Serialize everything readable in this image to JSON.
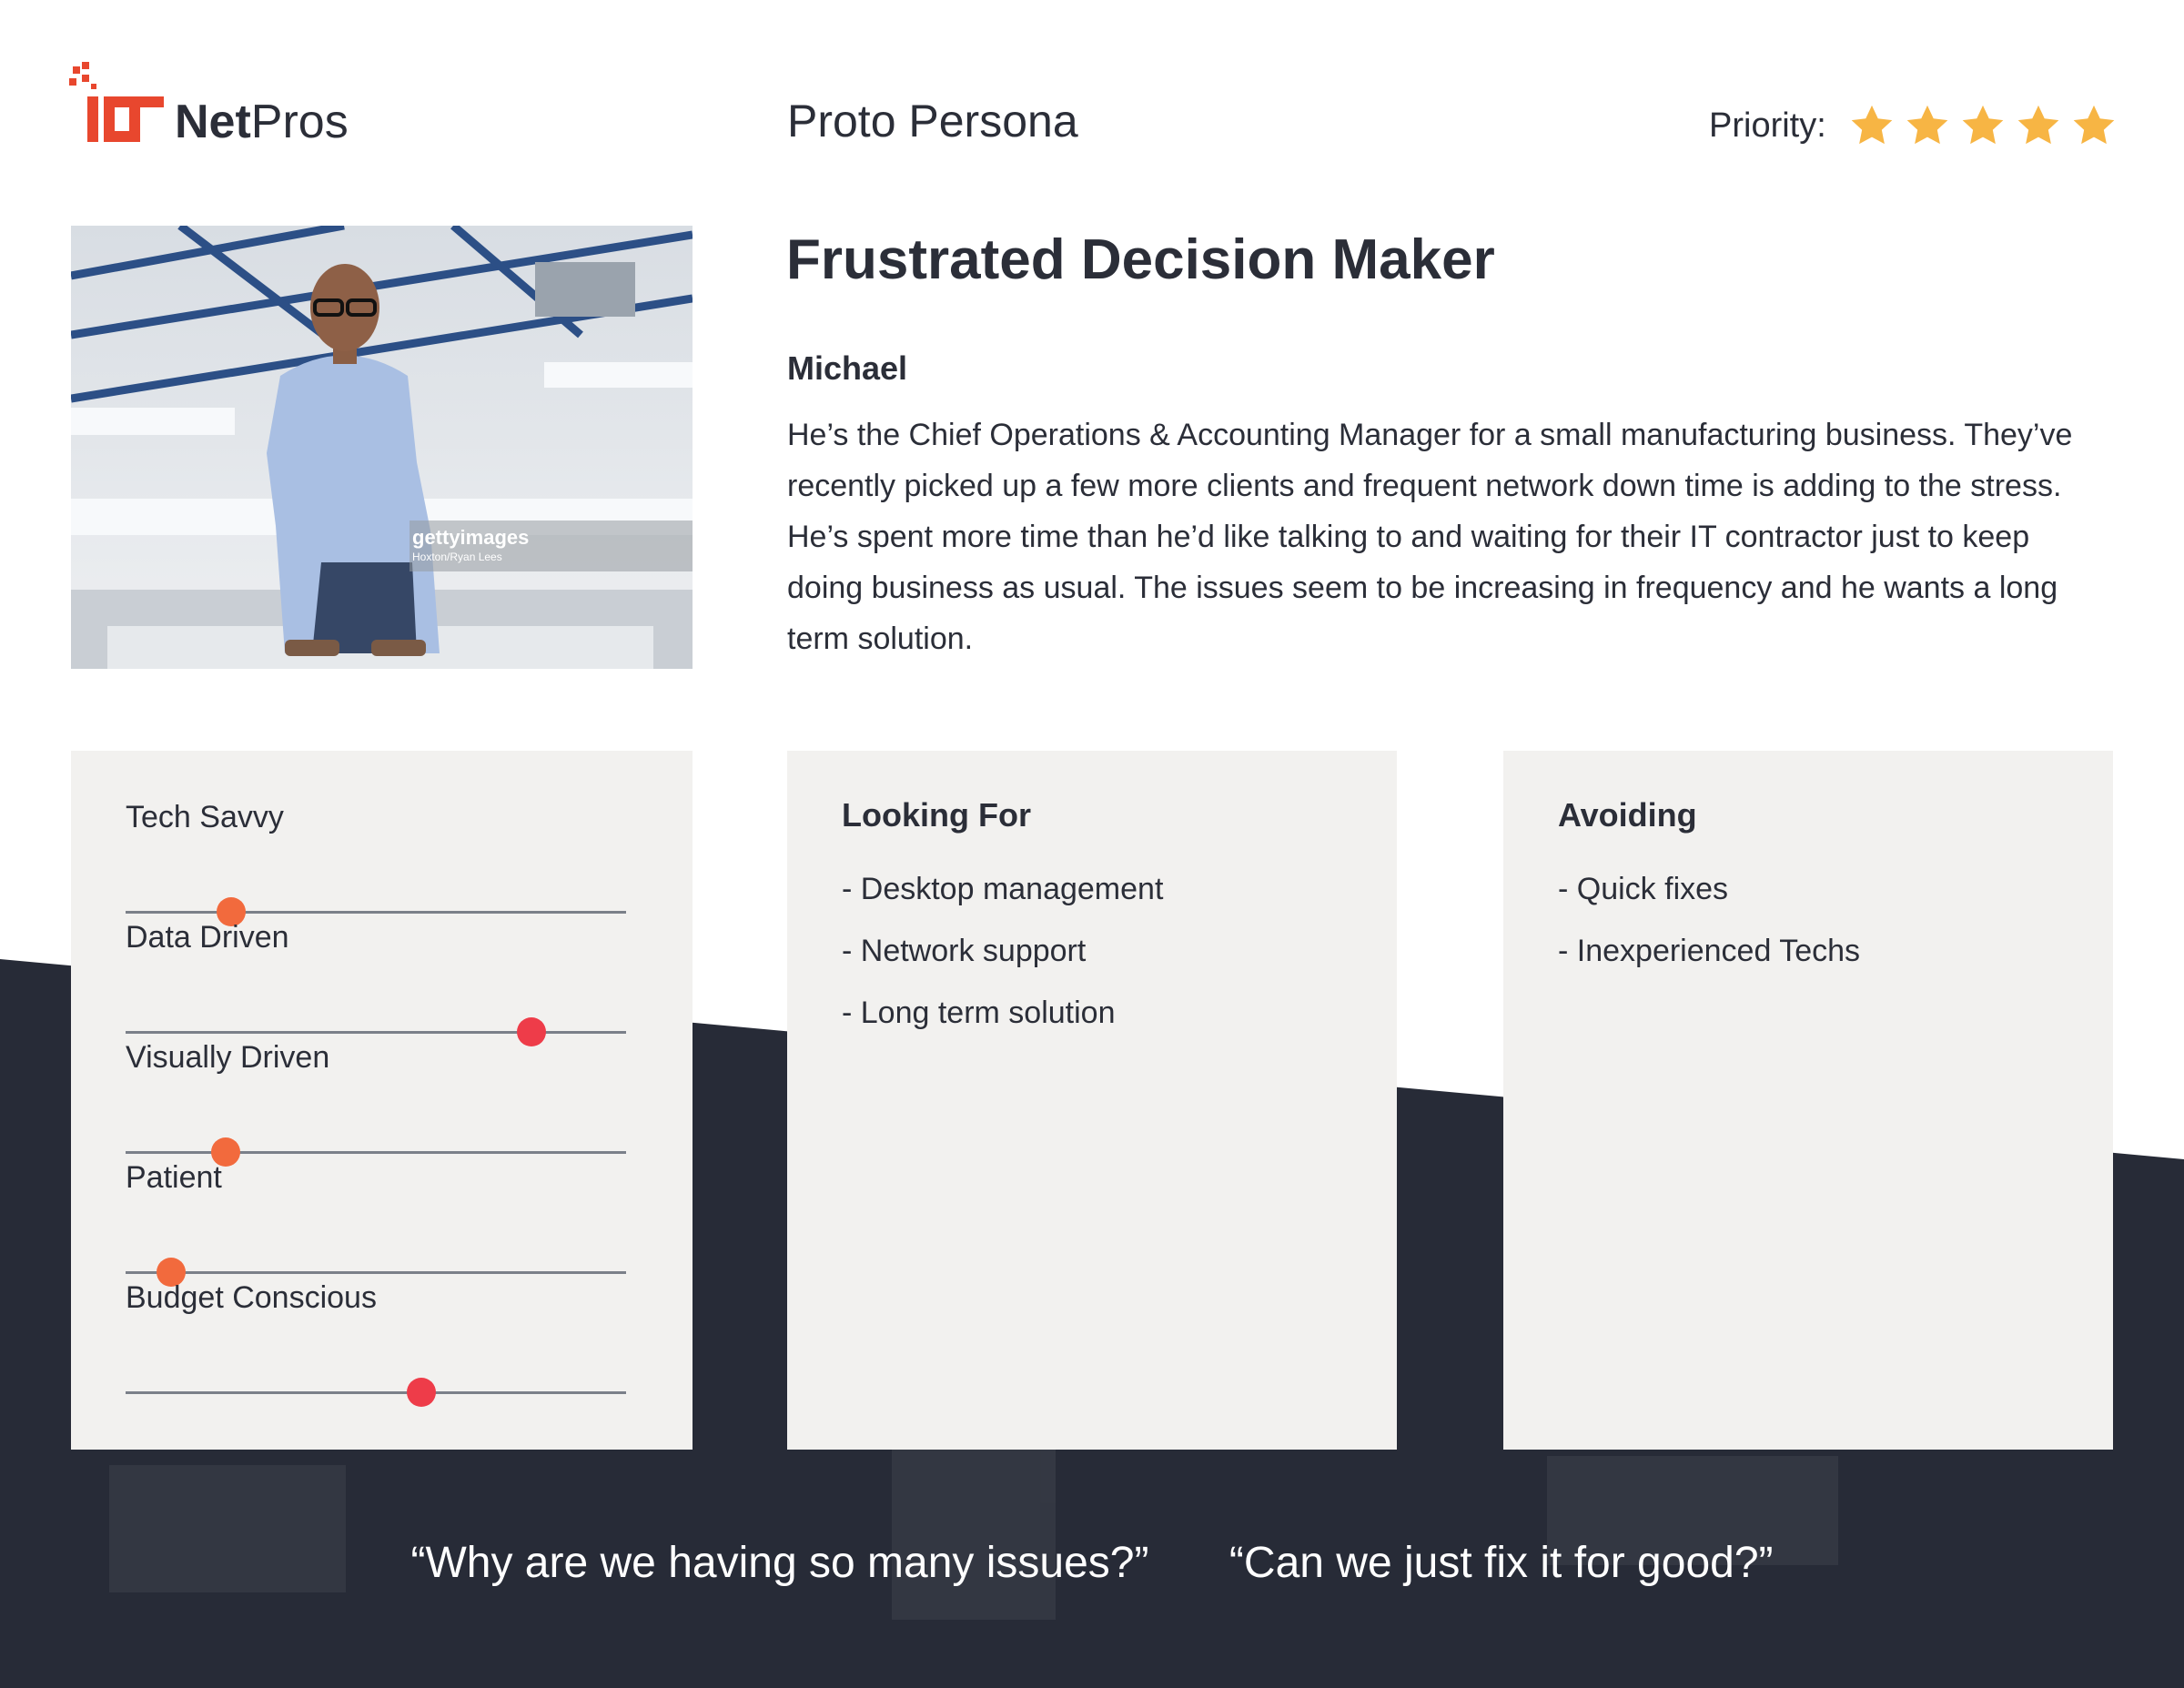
{
  "header": {
    "logo_icon": "it-pixel-logo-icon",
    "brand_bold": "Net",
    "brand_light": "Pros",
    "title": "Proto Persona",
    "priority_label": "Priority:",
    "priority_stars": 5,
    "star_color": "#f7b544"
  },
  "photo": {
    "watermark_brand": "gettyimages",
    "watermark_credit": "Hoxton/Ryan Lees"
  },
  "persona": {
    "title": "Frustrated Decision Maker",
    "name": "Michael",
    "description": "He’s the Chief Operations & Accounting Manager for a small manufacturing business. They’ve recently picked up a few more clients and frequent network down time is adding to the stress. He’s spent more time than he’d like talking to and waiting for their IT contractor just to keep doing business as usual. The issues seem to be increasing in frequency and he wants a long term solution."
  },
  "traits": [
    {
      "label": "Tech Savvy",
      "level": 0.21,
      "color": "#f26a3d"
    },
    {
      "label": "Data Driven",
      "level": 0.81,
      "color": "#ee3c49"
    },
    {
      "label": "Visually Driven",
      "level": 0.2,
      "color": "#f26a3d"
    },
    {
      "label": "Patient",
      "level": 0.09,
      "color": "#f26a3d"
    },
    {
      "label": "Budget Conscious",
      "level": 0.59,
      "color": "#ee3c49"
    }
  ],
  "looking_for": {
    "heading": "Looking For",
    "items": [
      "- Desktop management",
      "- Network support",
      "- Long term solution"
    ]
  },
  "avoiding": {
    "heading": "Avoiding",
    "items": [
      "- Quick fixes",
      "- Inexperienced Techs"
    ]
  },
  "quotes": [
    "“Why are we having so many issues?”",
    "“Can we just fix it for good?”"
  ],
  "colors": {
    "dark_band": "#272b37",
    "card_bg": "#f2f1ef",
    "logo_red": "#e8472e",
    "text": "#2b2e38"
  }
}
